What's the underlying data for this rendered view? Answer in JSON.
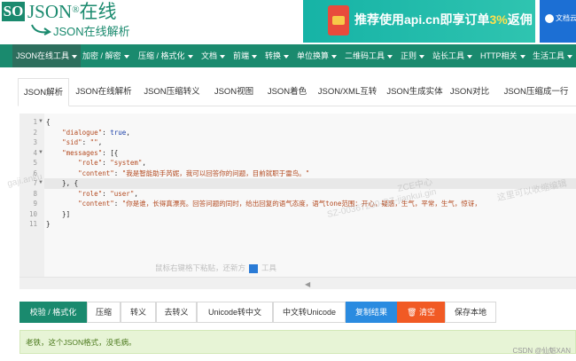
{
  "logo": {
    "so": "SO",
    "json": "JSON",
    "reg": "®",
    "cn": "在线",
    "sub": "JSON在线解析"
  },
  "ad": {
    "text_a": "推荐使用api.cn即享订单",
    "text_b": "3%",
    "text_c": "返佣",
    "side_text": "文档云"
  },
  "nav": [
    "JSON在线工具",
    "加密 / 解密",
    "压缩 / 格式化",
    "文档",
    "前端",
    "转换",
    "单位换算",
    "二维码工具",
    "正则",
    "站长工具",
    "HTTP相关",
    "生活工具"
  ],
  "tabs": [
    "JSON解析",
    "JSON在线解析",
    "JSON压缩转义",
    "JSON视图",
    "JSON着色",
    "JSON/XML互转",
    "JSON生成实体",
    "JSON对比",
    "JSON压缩成一行"
  ],
  "editor": {
    "line_numbers": [
      "1",
      "2",
      "3",
      "4",
      "5",
      "6",
      "7",
      "8",
      "9",
      "10",
      "11"
    ],
    "lines": [
      [
        {
          "t": "{",
          "c": "p"
        }
      ],
      [
        {
          "t": "    ",
          "c": "p"
        },
        {
          "t": "\"dialogue\"",
          "c": "k"
        },
        {
          "t": ": ",
          "c": "p"
        },
        {
          "t": "true",
          "c": "b"
        },
        {
          "t": ",",
          "c": "p"
        }
      ],
      [
        {
          "t": "    ",
          "c": "p"
        },
        {
          "t": "\"sid\"",
          "c": "k"
        },
        {
          "t": ": ",
          "c": "p"
        },
        {
          "t": "\"\"",
          "c": "s"
        },
        {
          "t": ",",
          "c": "p"
        }
      ],
      [
        {
          "t": "    ",
          "c": "p"
        },
        {
          "t": "\"messages\"",
          "c": "k"
        },
        {
          "t": ": [{",
          "c": "p"
        }
      ],
      [
        {
          "t": "        ",
          "c": "p"
        },
        {
          "t": "\"role\"",
          "c": "k"
        },
        {
          "t": ": ",
          "c": "p"
        },
        {
          "t": "\"system\"",
          "c": "s"
        },
        {
          "t": ",",
          "c": "p"
        }
      ],
      [
        {
          "t": "        ",
          "c": "p"
        },
        {
          "t": "\"content\"",
          "c": "k"
        },
        {
          "t": ": ",
          "c": "p"
        },
        {
          "t": "\"我是智能助手芮妮，我可以回答你的问题，目前就职于雷鸟。\"",
          "c": "s"
        }
      ],
      [
        {
          "t": "    }, {",
          "c": "p"
        }
      ],
      [
        {
          "t": "        ",
          "c": "p"
        },
        {
          "t": "\"role\"",
          "c": "k"
        },
        {
          "t": ": ",
          "c": "p"
        },
        {
          "t": "\"user\"",
          "c": "s"
        },
        {
          "t": ",",
          "c": "p"
        }
      ],
      [
        {
          "t": "        ",
          "c": "p"
        },
        {
          "t": "\"content\"",
          "c": "k"
        },
        {
          "t": ": ",
          "c": "p"
        },
        {
          "t": "\"你是谁，长得真漂亮。回答问题的同时，给出回复的语气态度，语气tone范围：开心，疑惑，生气，平常，生气，惊讶，",
          "c": "s"
        }
      ],
      [
        {
          "t": "    }]",
          "c": "p"
        }
      ],
      [
        {
          "t": "}",
          "c": "p"
        }
      ]
    ],
    "hint_a": "鼠标右键格下粘贴，还新方",
    "hint_b": "工具",
    "watermarks": [
      "gaji.anku",
      "ZCE中心",
      "SZ-00367230-QZ-jiankui.gin",
      "这里可以收缩编辑"
    ]
  },
  "toolbar": [
    {
      "label": "校验 / 格式化",
      "style": "green"
    },
    {
      "label": "压缩",
      "style": "plain"
    },
    {
      "label": "转义",
      "style": "plain"
    },
    {
      "label": "去转义",
      "style": "plain"
    },
    {
      "label": "Unicode转中文",
      "style": "plain"
    },
    {
      "label": "中文转Unicode",
      "style": "plain"
    },
    {
      "label": "复制结果",
      "style": "blue"
    },
    {
      "label": "清空",
      "style": "orange"
    },
    {
      "label": "保存本地",
      "style": "plain"
    }
  ],
  "status": "老铁，这个JSON格式，没毛病。",
  "footer": "CSDN @仙魁XAN",
  "colors": {
    "brand": "#1a8a6e",
    "ad": "#16b3a6",
    "blue": "#2a8be0",
    "orange": "#f15a24",
    "ok_bg": "#e7f4d6"
  }
}
